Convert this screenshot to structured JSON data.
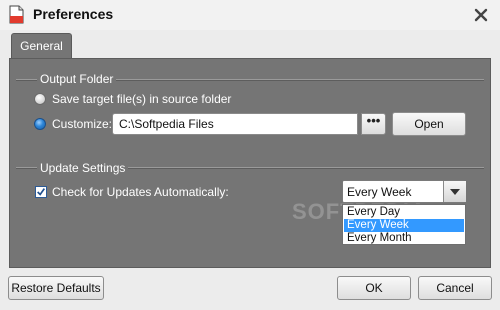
{
  "window": {
    "title": "Preferences"
  },
  "tabs": [
    {
      "label": "General",
      "active": true
    }
  ],
  "output_folder": {
    "title": "Output Folder",
    "option_source": "Save target file(s) in source folder",
    "option_customize": "Customize:",
    "path_value": "C:\\Softpedia Files",
    "browse_label": "•••",
    "open_label": "Open",
    "selected_option": "customize"
  },
  "update_settings": {
    "title": "Update Settings",
    "check_label": "Check for Updates Automatically:",
    "checked": true,
    "selected": "Every Week",
    "options": [
      "Every Day",
      "Every Week",
      "Every Month"
    ]
  },
  "footer": {
    "restore_label": "Restore Defaults",
    "ok_label": "OK",
    "cancel_label": "Cancel"
  },
  "watermark": "SOFTPEDIA",
  "colors": {
    "accent": "#3399ff",
    "panel": "#757575",
    "window": "#ececec"
  }
}
